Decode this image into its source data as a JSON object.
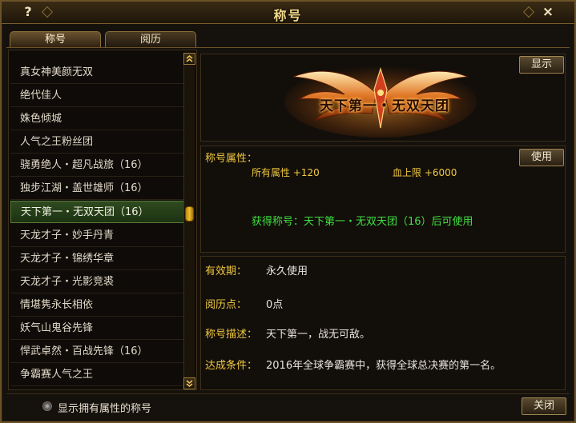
{
  "window": {
    "title": "称号",
    "help_icon": "?",
    "close_icon": "×"
  },
  "tabs": [
    {
      "label": "称号",
      "active": true
    },
    {
      "label": "阅历",
      "active": false
    }
  ],
  "title_list": [
    {
      "label": "真女神美颜无双"
    },
    {
      "label": "绝代佳人"
    },
    {
      "label": "姝色倾城"
    },
    {
      "label": "人气之王粉丝团"
    },
    {
      "label": "骁勇绝人・超凡战旅（16）"
    },
    {
      "label": "独步江湖・盖世雄师（16）"
    },
    {
      "label": "天下第一・无双天团（16）",
      "selected": true
    },
    {
      "label": "天龙才子・妙手丹青"
    },
    {
      "label": "天龙才子・锦绣华章"
    },
    {
      "label": "天龙才子・光影竞裘"
    },
    {
      "label": "情堪隽永长相依"
    },
    {
      "label": "妖气山鬼谷先锋"
    },
    {
      "label": "悍武卓然・百战先锋（16）"
    },
    {
      "label": "争霸赛人气之王"
    }
  ],
  "scroll": {
    "up_icon": "chevron-double-up",
    "down_icon": "chevron-double-down"
  },
  "emblem": {
    "text": "天下第一・无双天团"
  },
  "buttons": {
    "show": "显示",
    "use": "使用",
    "close": "关闭"
  },
  "attributes": {
    "title": "称号属性：",
    "all_attr": "所有属性 +120",
    "hp_max": "血上限 +6000",
    "obtain": "获得称号：天下第一・无双天团（16）后可使用"
  },
  "info": {
    "validity_label": "有效期：",
    "validity_value": "永久使用",
    "exp_label": "阅历点：",
    "exp_value": "0点",
    "desc_label": "称号描述：",
    "desc_value": "天下第一，战无可敌。",
    "cond_label": "达成条件：",
    "cond_value": "2016年全球争霸赛中，获得全球总决赛的第一名。"
  },
  "footer": {
    "filter_label": "显示拥有属性的称号"
  },
  "colors": {
    "gold": "#f0c840",
    "green": "#40e040",
    "selected_bg": "#2f4a1f"
  }
}
